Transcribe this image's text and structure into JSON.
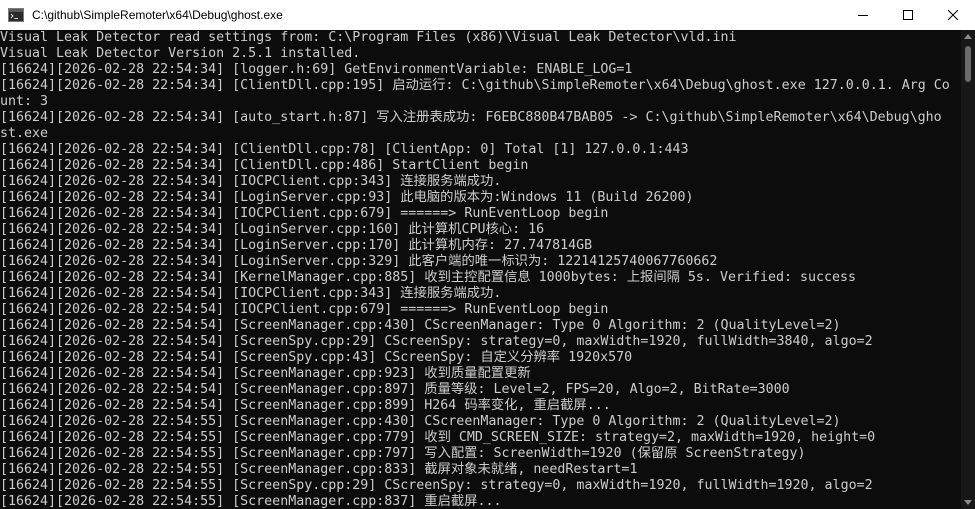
{
  "window": {
    "title": "C:\\github\\SimpleRemoter\\x64\\Debug\\ghost.exe",
    "icon": "console-app-icon",
    "controls": {
      "minimize_icon": "minimize-icon",
      "maximize_icon": "maximize-icon",
      "close_icon": "close-icon"
    }
  },
  "colors": {
    "console_background": "#0c0c0c",
    "console_text": "#cccccc",
    "titlebar_background": "#ffffff"
  },
  "console": {
    "lines": [
      "Visual Leak Detector read settings from: C:\\Program Files (x86)\\Visual Leak Detector\\vld.ini",
      "Visual Leak Detector Version 2.5.1 installed.",
      "[16624][2026-02-28 22:54:34] [logger.h:69] GetEnvironmentVariable: ENABLE_LOG=1",
      "[16624][2026-02-28 22:54:34] [ClientDll.cpp:195] 启动运行: C:\\github\\SimpleRemoter\\x64\\Debug\\ghost.exe 127.0.0.1. Arg Co",
      "unt: 3",
      "[16624][2026-02-28 22:54:34] [auto_start.h:87] 写入注册表成功: F6EBC880B47BAB05 -> C:\\github\\SimpleRemoter\\x64\\Debug\\gho",
      "st.exe",
      "[16624][2026-02-28 22:54:34] [ClientDll.cpp:78] [ClientApp: 0] Total [1] 127.0.0.1:443",
      "[16624][2026-02-28 22:54:34] [ClientDll.cpp:486] StartClient begin",
      "[16624][2026-02-28 22:54:34] [IOCPClient.cpp:343] 连接服务端成功.",
      "[16624][2026-02-28 22:54:34] [LoginServer.cpp:93] 此电脑的版本为:Windows 11 (Build 26200)",
      "[16624][2026-02-28 22:54:34] [IOCPClient.cpp:679] ======> RunEventLoop begin",
      "[16624][2026-02-28 22:54:34] [LoginServer.cpp:160] 此计算机CPU核心: 16",
      "[16624][2026-02-28 22:54:34] [LoginServer.cpp:170] 此计算机内存: 27.747814GB",
      "[16624][2026-02-28 22:54:34] [LoginServer.cpp:329] 此客户端的唯一标识为: 12214125740067760662",
      "[16624][2026-02-28 22:54:34] [KernelManager.cpp:885] 收到主控配置信息 1000bytes: 上报间隔 5s. Verified: success",
      "[16624][2026-02-28 22:54:54] [IOCPClient.cpp:343] 连接服务端成功.",
      "[16624][2026-02-28 22:54:54] [IOCPClient.cpp:679] ======> RunEventLoop begin",
      "[16624][2026-02-28 22:54:54] [ScreenManager.cpp:430] CScreenManager: Type 0 Algorithm: 2 (QualityLevel=2)",
      "[16624][2026-02-28 22:54:54] [ScreenSpy.cpp:29] CScreenSpy: strategy=0, maxWidth=1920, fullWidth=3840, algo=2",
      "[16624][2026-02-28 22:54:54] [ScreenSpy.cpp:43] CScreenSpy: 自定义分辨率 1920x570",
      "[16624][2026-02-28 22:54:54] [ScreenManager.cpp:923] 收到质量配置更新",
      "[16624][2026-02-28 22:54:54] [ScreenManager.cpp:897] 质量等级: Level=2, FPS=20, Algo=2, BitRate=3000",
      "[16624][2026-02-28 22:54:54] [ScreenManager.cpp:899] H264 码率变化, 重启截屏...",
      "[16624][2026-02-28 22:54:55] [ScreenManager.cpp:430] CScreenManager: Type 0 Algorithm: 2 (QualityLevel=2)",
      "[16624][2026-02-28 22:54:55] [ScreenManager.cpp:779] 收到 CMD_SCREEN_SIZE: strategy=2, maxWidth=1920, height=0",
      "[16624][2026-02-28 22:54:55] [ScreenManager.cpp:797] 写入配置: ScreenWidth=1920 (保留原 ScreenStrategy)",
      "[16624][2026-02-28 22:54:55] [ScreenManager.cpp:833] 截屏对象未就绪, needRestart=1",
      "[16624][2026-02-28 22:54:55] [ScreenSpy.cpp:29] CScreenSpy: strategy=0, maxWidth=1920, fullWidth=1920, algo=2",
      "[16624][2026-02-28 22:54:55] [ScreenManager.cpp:837] 重启截屏..."
    ]
  },
  "scrollbar": {
    "position_fraction": 0.0
  }
}
